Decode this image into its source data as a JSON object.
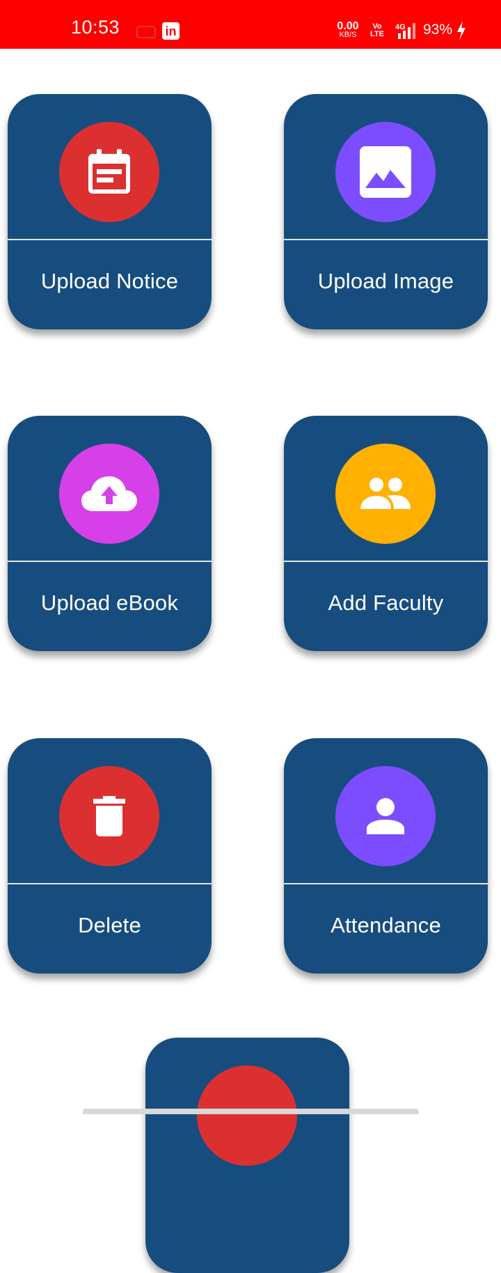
{
  "status_bar": {
    "time": "10:53",
    "net_speed_value": "0.00",
    "net_speed_unit": "KB/S",
    "volte_top": "Vo",
    "volte_bottom": "LTE",
    "network": "4G",
    "battery": "93%",
    "background_color": "#ff0000"
  },
  "cards": [
    {
      "label": "Upload Notice",
      "icon": "notice-calendar-icon",
      "circle_color": "#dc3030"
    },
    {
      "label": "Upload Image",
      "icon": "image-icon",
      "circle_color": "#7c4dff"
    },
    {
      "label": "Upload eBook",
      "icon": "cloud-upload-icon",
      "circle_color": "#d640e9"
    },
    {
      "label": "Add Faculty",
      "icon": "people-icon",
      "circle_color": "#ffb000"
    },
    {
      "label": "Delete",
      "icon": "trash-icon",
      "circle_color": "#dc3030"
    },
    {
      "label": "Attendance",
      "icon": "person-icon",
      "circle_color": "#7c4dff"
    }
  ],
  "partial_card": {
    "circle_color": "#dc3030"
  },
  "theme": {
    "card_color": "#174d7e"
  }
}
